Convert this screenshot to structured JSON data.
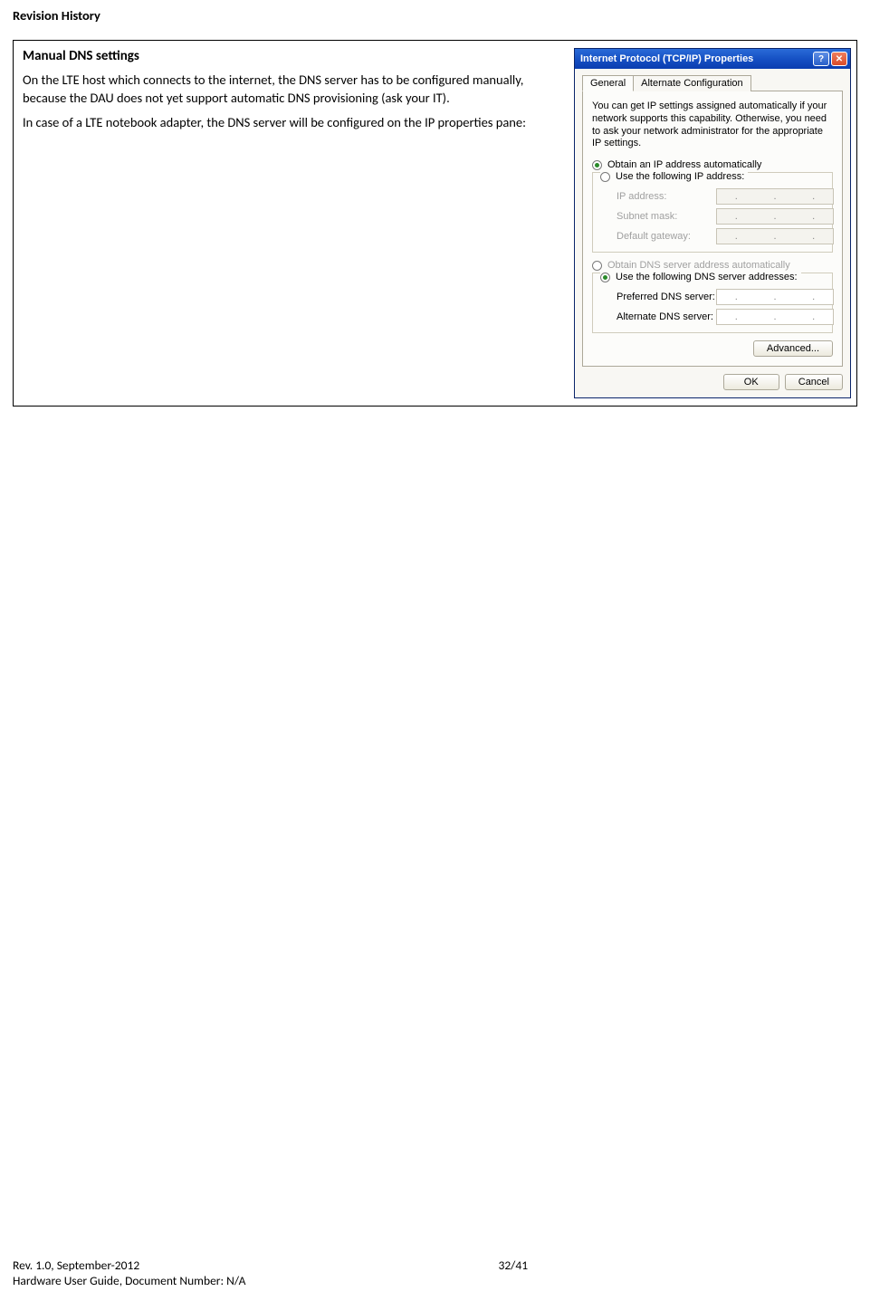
{
  "header": {
    "title": "Revision History"
  },
  "section": {
    "title": "Manual DNS settings",
    "para1": "On the LTE host which connects to the internet, the DNS server has to be configured manually, because the DAU does not yet support automatic DNS provisioning (ask your IT).",
    "para2": "In case of a LTE notebook adapter, the DNS server will be configured on the IP properties pane:"
  },
  "dialog": {
    "title": "Internet Protocol (TCP/IP) Properties",
    "help_btn": "?",
    "close_btn": "✕",
    "tabs": {
      "general": "General",
      "alt": "Alternate Configuration"
    },
    "intro": "You can get IP settings assigned automatically if your network supports this capability. Otherwise, you need to ask your network administrator for the appropriate IP settings.",
    "ip_auto": "Obtain an IP address automatically",
    "ip_manual": "Use the following IP address:",
    "ip_fields": {
      "ip": "IP address:",
      "mask": "Subnet mask:",
      "gw": "Default gateway:"
    },
    "dns_auto": "Obtain DNS server address automatically",
    "dns_manual": "Use the following DNS server addresses:",
    "dns_fields": {
      "pref": "Preferred DNS server:",
      "alt": "Alternate DNS server:"
    },
    "buttons": {
      "advanced": "Advanced...",
      "ok": "OK",
      "cancel": "Cancel"
    },
    "ip_dot": "."
  },
  "footer": {
    "rev": "Rev. 1.0, September-2012",
    "page": "32/41",
    "guide": "Hardware User Guide, Document Number: N/A"
  }
}
